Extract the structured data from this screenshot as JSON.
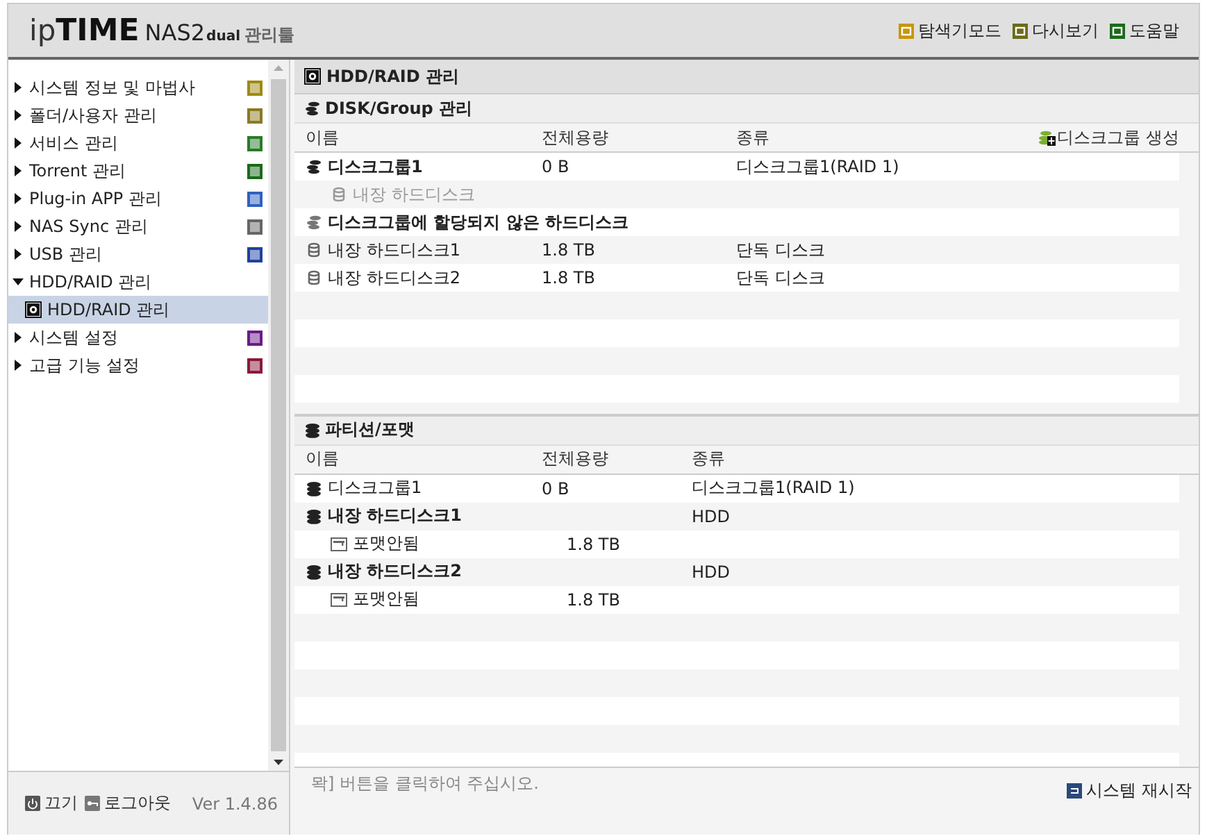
{
  "header": {
    "logo": {
      "prefix": "ip",
      "brand": "TIME",
      "model": "NAS2",
      "edition": "dual",
      "suffix": "관리툴"
    },
    "links": [
      {
        "label": "탐색기모드",
        "color": "#c8960a"
      },
      {
        "label": "다시보기",
        "color": "#6b6b1a"
      },
      {
        "label": "도움말",
        "color": "#1a6a1a"
      }
    ]
  },
  "sidebar": {
    "items": [
      {
        "label": "시스템 정보 및 마법사",
        "expanded": false,
        "color": "#a08a10"
      },
      {
        "label": "폴더/사용자 관리",
        "expanded": false,
        "color": "#8a7a20"
      },
      {
        "label": "서비스 관리",
        "expanded": false,
        "color": "#2a7a2a"
      },
      {
        "label": "Torrent 관리",
        "expanded": false,
        "color": "#1a6a1a"
      },
      {
        "label": "Plug-in APP 관리",
        "expanded": false,
        "color": "#3060c0"
      },
      {
        "label": "NAS Sync 관리",
        "expanded": false,
        "color": "#666666"
      },
      {
        "label": "USB 관리",
        "expanded": false,
        "color": "#2040a0"
      },
      {
        "label": "HDD/RAID 관리",
        "expanded": true,
        "children": [
          {
            "label": "HDD/RAID 관리",
            "selected": true
          }
        ]
      },
      {
        "label": "시스템 설정",
        "expanded": false,
        "color": "#6a1a8a"
      },
      {
        "label": "고급 기능 설정",
        "expanded": false,
        "color": "#8a1a3a"
      }
    ],
    "footer": {
      "power": "끄기",
      "logout": "로그아웃",
      "version": "Ver 1.4.86"
    }
  },
  "main": {
    "title": "HDD/RAID 관리",
    "sections": [
      {
        "title": "DISK/Group 관리",
        "columns": [
          "이름",
          "전체용량",
          "종류"
        ],
        "action": "디스크그룹 생성",
        "rows": [
          {
            "kind": "group",
            "name": "디스크그룹1",
            "capacity": "0 B",
            "type": "디스크그룹1(RAID 1)",
            "children": [
              {
                "kind": "member",
                "name": "내장 하드디스크"
              }
            ]
          },
          {
            "kind": "unassigned",
            "name": "디스크그룹에 할당되지 않은 하드디스크",
            "children": [
              {
                "kind": "disk",
                "name": "내장 하드디스크1",
                "capacity": "1.8 TB",
                "type": "단독 디스크"
              },
              {
                "kind": "disk",
                "name": "내장 하드디스크2",
                "capacity": "1.8 TB",
                "type": "단독 디스크"
              }
            ]
          }
        ]
      },
      {
        "title": "파티션/포맷",
        "columns": [
          "이름",
          "전체용량",
          "종류"
        ],
        "rows": [
          {
            "kind": "volume",
            "name": "디스크그룹1",
            "capacity": "0 B",
            "type": "디스크그룹1(RAID 1)"
          },
          {
            "kind": "drive",
            "name": "내장 하드디스크1",
            "type": "HDD",
            "children": [
              {
                "kind": "partition",
                "name": "포맷안됨",
                "capacity": "1.8 TB"
              }
            ]
          },
          {
            "kind": "drive",
            "name": "내장 하드디스크2",
            "type": "HDD",
            "children": [
              {
                "kind": "partition",
                "name": "포맷안됨",
                "capacity": "1.8 TB"
              }
            ]
          }
        ]
      }
    ],
    "status": "뫅] 버튼을 클릭하여 주십시오.",
    "restart": "시스템 재시작"
  }
}
